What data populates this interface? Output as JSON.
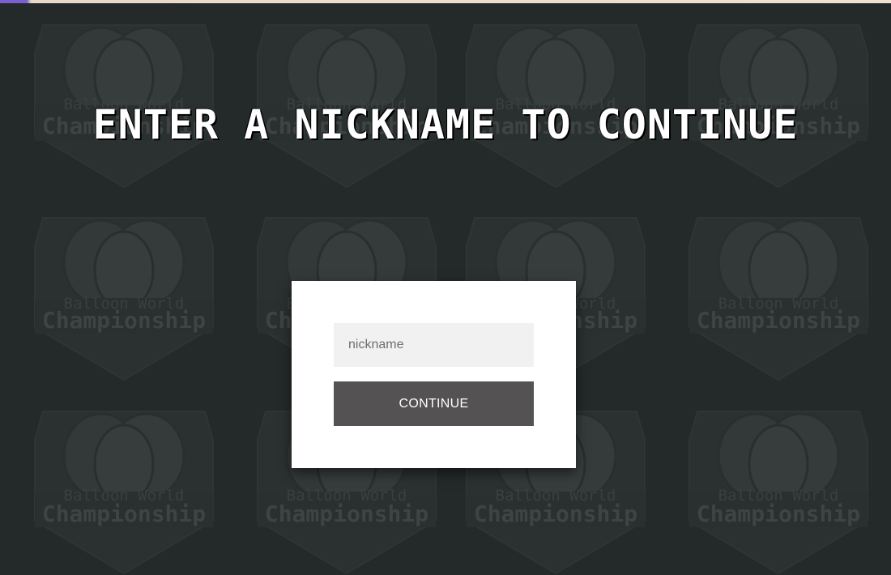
{
  "page": {
    "headline": "ENTER A NICKNAME TO CONTINUE"
  },
  "background_logo": {
    "line1": "Balloon World",
    "line2": "Championship"
  },
  "form": {
    "nickname_placeholder": "nickname",
    "nickname_value": "",
    "continue_label": "CONTINUE"
  },
  "colors": {
    "background": "#242929",
    "card": "#ffffff",
    "input_bg": "#f1f1f1",
    "button_bg": "#545253",
    "headline": "#ffffff"
  }
}
